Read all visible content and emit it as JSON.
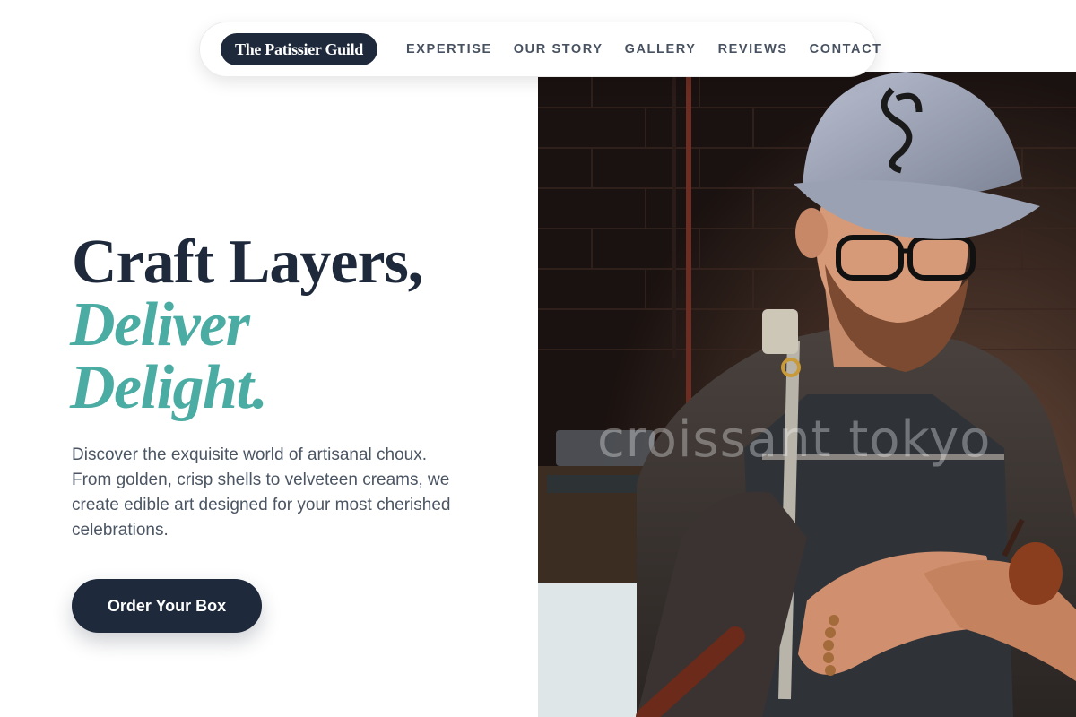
{
  "nav": {
    "brand": "The Patissier Guild",
    "links": [
      "EXPERTISE",
      "OUR STORY",
      "GALLERY",
      "REVIEWS",
      "CONTACT"
    ]
  },
  "hero": {
    "headline_line1": "Craft Layers,",
    "headline_line2": "Deliver",
    "headline_line3": "Delight.",
    "description": "Discover the exquisite world of artisanal choux. From golden, crisp shells to velveteen creams, we create edible art designed for your most cherished celebrations.",
    "cta_label": "Order Your Box"
  },
  "photo": {
    "watermark": "croissant tokyo"
  },
  "colors": {
    "navy": "#1e293b",
    "teal_accent": "#4aaca3",
    "body_text": "#4b5563"
  }
}
